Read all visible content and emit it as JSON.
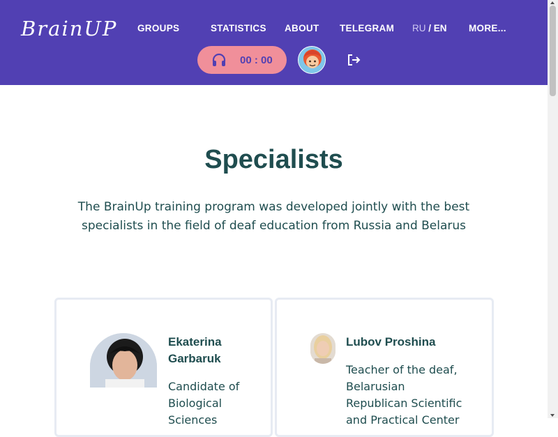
{
  "header": {
    "logo": "BrainUP",
    "nav": [
      "GROUPS",
      "STATISTICS",
      "ABOUT",
      "TELEGRAM"
    ],
    "lang_ru": "RU",
    "lang_sep": " / ",
    "lang_en": "EN",
    "more": "MORE...",
    "timer": "00 : 00"
  },
  "main": {
    "title": "Specialists",
    "subtitle": "The BrainUp training program was developed jointly with the best specialists in the field of deaf education from Russia and Belarus",
    "specialists": [
      {
        "name": "Ekaterina Garbaruk",
        "description": "Candidate of Biological Sciences"
      },
      {
        "name": "Lubov Proshina",
        "description": "Teacher of the deaf, Belarusian Republican Scientific and Practical Center"
      }
    ]
  },
  "colors": {
    "header_bg": "#5140b3",
    "timer_bg": "#f08f9a",
    "heading_text": "#1f4d4f",
    "card_border": "#e7ebf3"
  },
  "icons": [
    "headphones-icon",
    "logout-icon"
  ]
}
